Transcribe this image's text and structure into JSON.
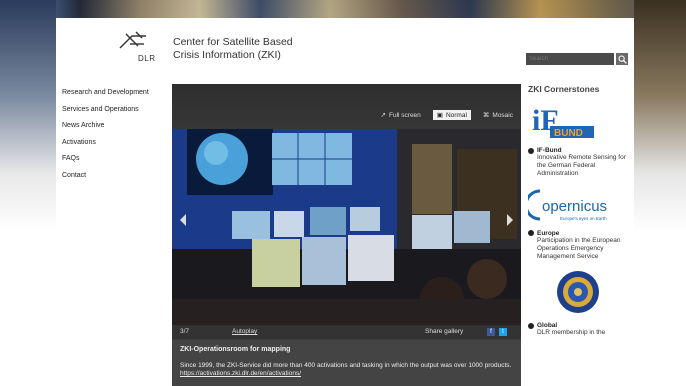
{
  "header": {
    "logo_text": "DLR",
    "title_line1": "Center for Satellite Based",
    "title_line2": "Crisis Information (ZKI)",
    "search_placeholder": "Search"
  },
  "nav": {
    "items": [
      {
        "label": "Research and Development"
      },
      {
        "label": "Services and Operations"
      },
      {
        "label": "News Archive"
      },
      {
        "label": "Activations"
      },
      {
        "label": "FAQs"
      },
      {
        "label": "Contact"
      }
    ]
  },
  "gallery": {
    "views": [
      {
        "label": "Full screen",
        "active": false
      },
      {
        "label": "Normal",
        "active": true
      },
      {
        "label": "Mosaic",
        "active": false
      }
    ],
    "counter": "3/7",
    "autoplay": "Autoplay",
    "share": "Share gallery",
    "caption_title": "ZKI-Operationsroom for mapping",
    "caption_text": "Since 1999, the ZKI-Service did more than 400 activations and tasking in which the output was over 1000 products.",
    "caption_link": "https://activations.zki.dlr.de/en/activations/"
  },
  "cornerstones": {
    "heading": "ZKI Cornerstones",
    "partners": [
      {
        "logo_text": "BUND",
        "name": "IF-Bund",
        "desc": "Innovative Remote Sensing for the German Federal Administration"
      },
      {
        "logo_text": "opernicus",
        "logo_sub": "Europe's eyes on Earth",
        "name": "Europe",
        "desc": "Participation in the European Operations Emergency Management Service"
      },
      {
        "name": "Global",
        "desc": "DLR membership in the"
      }
    ]
  },
  "colors": {
    "ifbund": "#1f66b5",
    "ifbund_orange": "#f0a030",
    "copernicus": "#1a67b0",
    "dark_panel": "#3c3c3c"
  }
}
